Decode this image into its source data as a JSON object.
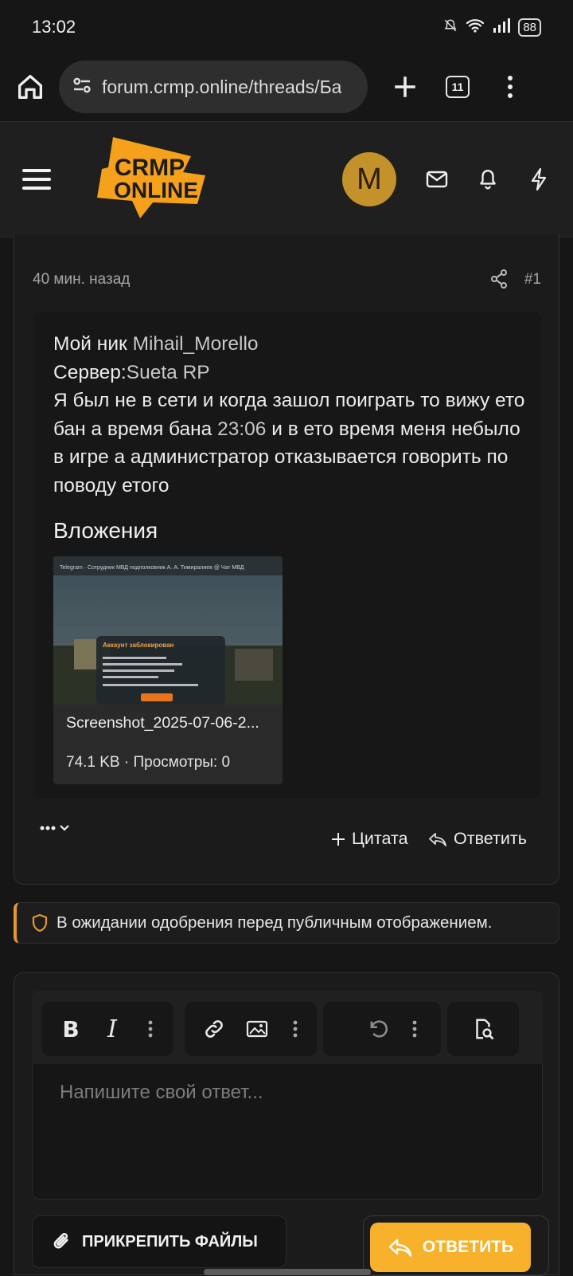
{
  "status": {
    "time": "13:02",
    "battery": "88"
  },
  "browser": {
    "url": "forum.crmp.online/threads/Ба",
    "tab_count": "11"
  },
  "header": {
    "logo_line1": "CRMP",
    "logo_line2": "ONLINE",
    "avatar_letter": "M"
  },
  "post": {
    "time_ago": "40 мин. назад",
    "number": "#1",
    "nick_label": "Мой ник",
    "nick_value": "Mihail_Morello",
    "server_label": "Сервер:",
    "server_value": "Sueta RP",
    "text_part1": "Я был не в сети и когда зашол поиграть то вижу ето бан а время бана ",
    "ban_time": "23:06",
    "text_part2": " и в ето время меня небыло в игре а администратор отказывается говорить по поводу етого",
    "attachments_title": "Вложения",
    "attachment": {
      "name": "Screenshot_2025-07-06-2...",
      "size": "74.1 KB",
      "views": "Просмотры: 0",
      "thumb_title": "Аккаунт заблокирован",
      "thumb_header": "Telegram · Сотрудник МВД подполковник А. А. Тимиралиев @ Чат МВД"
    },
    "actions": {
      "quote": "Цитата",
      "reply": "Ответить"
    }
  },
  "notice": {
    "text": "В ожидании одобрения перед публичным отображением."
  },
  "editor": {
    "placeholder": "Напишите свой ответ...",
    "bold_label": "B",
    "italic_label": "I",
    "attach_label": "ПРИКРЕПИТЬ ФАЙЛЫ",
    "submit_label": "ОТВЕТИТЬ"
  },
  "colors": {
    "accent": "#f7b12a",
    "logo_orange": "#f5a11c",
    "avatar": "#c4922a",
    "notice_border": "#e5962c"
  }
}
